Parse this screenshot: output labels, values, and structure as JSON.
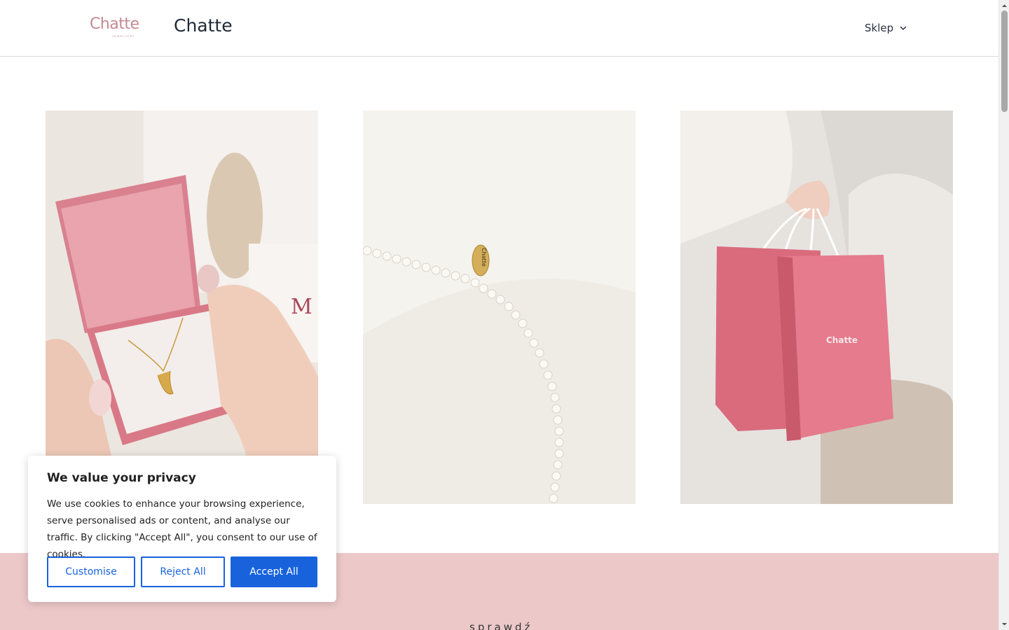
{
  "header": {
    "logo_text": "Chatte",
    "logo_subtext": "JEWELLERY",
    "site_title": "Chatte",
    "nav": {
      "shop_label": "Sklep"
    }
  },
  "gallery": {
    "images": [
      {
        "name": "pink-gift-box-moon-necklace"
      },
      {
        "name": "pearl-necklace-chatte-tag",
        "tag_text": "Chatte"
      },
      {
        "name": "pink-shopping-bags",
        "bag_text": "Chatte"
      }
    ]
  },
  "section": {
    "label": "sprawdź",
    "background": "#ecc8c9"
  },
  "cookie_banner": {
    "title": "We value your privacy",
    "text": "We use cookies to enhance your browsing experience, serve personalised ads or content, and analyse our traffic. By clicking \"Accept All\", you consent to our use of cookies.",
    "customise_label": "Customise",
    "reject_label": "Reject All",
    "accept_label": "Accept All",
    "accent_color": "#1863dc"
  }
}
